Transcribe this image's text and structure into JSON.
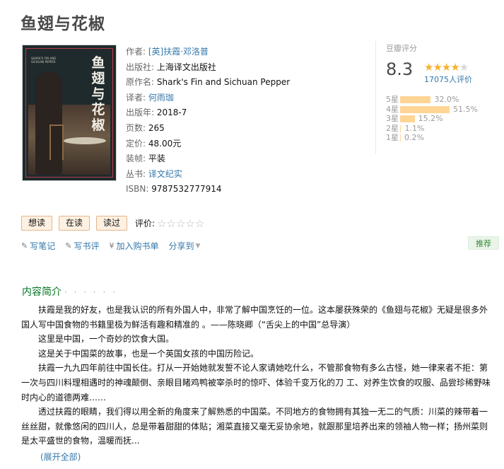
{
  "book": {
    "title": "鱼翅与花椒",
    "cover": {
      "title_chars": "鱼翅与花椒",
      "subtitle": "SHARK'S FIN AND SICHUAN PEPPER"
    }
  },
  "info": {
    "author_label": "作者:",
    "author": "[英]扶霞·邓洛普",
    "publisher_label": "出版社:",
    "publisher": "上海译文出版社",
    "original_label": "原作名:",
    "original": "Shark's Fin and Sichuan Pepper",
    "translator_label": "译者:",
    "translator": "何雨珈",
    "year_label": "出版年:",
    "year": "2018-7",
    "pages_label": "页数:",
    "pages": "265",
    "price_label": "定价:",
    "price": "48.00元",
    "binding_label": "装帧:",
    "binding": "平装",
    "series_label": "丛书:",
    "series": "译文纪实",
    "isbn_label": "ISBN:",
    "isbn": "9787532777914"
  },
  "rating": {
    "label": "豆瓣评分",
    "score": "8.3",
    "stars_on": "★★★★",
    "stars_off": "★",
    "votes": "17075人评价",
    "distribution": [
      {
        "label": "5星",
        "percent_text": "32.0%",
        "value": 32.0
      },
      {
        "label": "4星",
        "percent_text": "51.5%",
        "value": 51.5
      },
      {
        "label": "3星",
        "percent_text": "15.2%",
        "value": 15.2
      },
      {
        "label": "2星",
        "percent_text": "1.1%",
        "value": 1.1
      },
      {
        "label": "1星",
        "percent_text": "0.2%",
        "value": 0.2
      }
    ]
  },
  "actions": {
    "want": "想读",
    "reading": "在读",
    "read": "读过",
    "rate_label": "评价:",
    "rate_stars": "☆☆☆☆☆"
  },
  "links": {
    "note": "写笔记",
    "review": "写书评",
    "buy": "加入购书单",
    "share": "分享到"
  },
  "recommend": "推荐",
  "intro": {
    "title": "内容简介",
    "dots": "· · · · · ·",
    "paragraphs": [
      "扶霞是我的好友，也是我认识的所有外国人中，非常了解中国烹饪的一位。这本屡获殊荣的《鱼翅与花椒》无疑是很多外国人写中国食物的书籍里极为鲜活有趣和精准的 。——陈晓卿（“舌尖上的中国”总导演）",
      "这里是中国，一个奇妙的饮食大国。",
      "这是关于中国菜的故事，也是一个英国女孩的中国历险记。",
      "扶霞一九九四年前往中国长住。打从一开始她就发誓不论人家请她吃什么，不管那食物有多么古怪，她一律来者不拒：第一次与四川料理相遇时的神魂颠倒、亲眼目睹鸡鸭被宰杀时的惊吓、体验千变万化的刀 工、对养生饮食的叹服、品尝珍稀野味时内心的道德两难……",
      "透过扶霞的眼睛，我们得以用全新的角度来了解熟悉的中国菜。不同地方的食物拥有其独一无二的气质：川菜的辣带着一丝丝甜，就像悠闲的四川人，总是带着甜甜的体贴；湘菜直接又毫无妥协余地，就跟那里培养出来的领袖人物一样；扬州菜则是太平盛世的食物，温暖而抚..."
    ],
    "expand": "(展开全部)"
  },
  "colors": {
    "link": "#3377aa",
    "star": "#f5b42d",
    "bar": "#ffd596",
    "section": "#007722"
  }
}
